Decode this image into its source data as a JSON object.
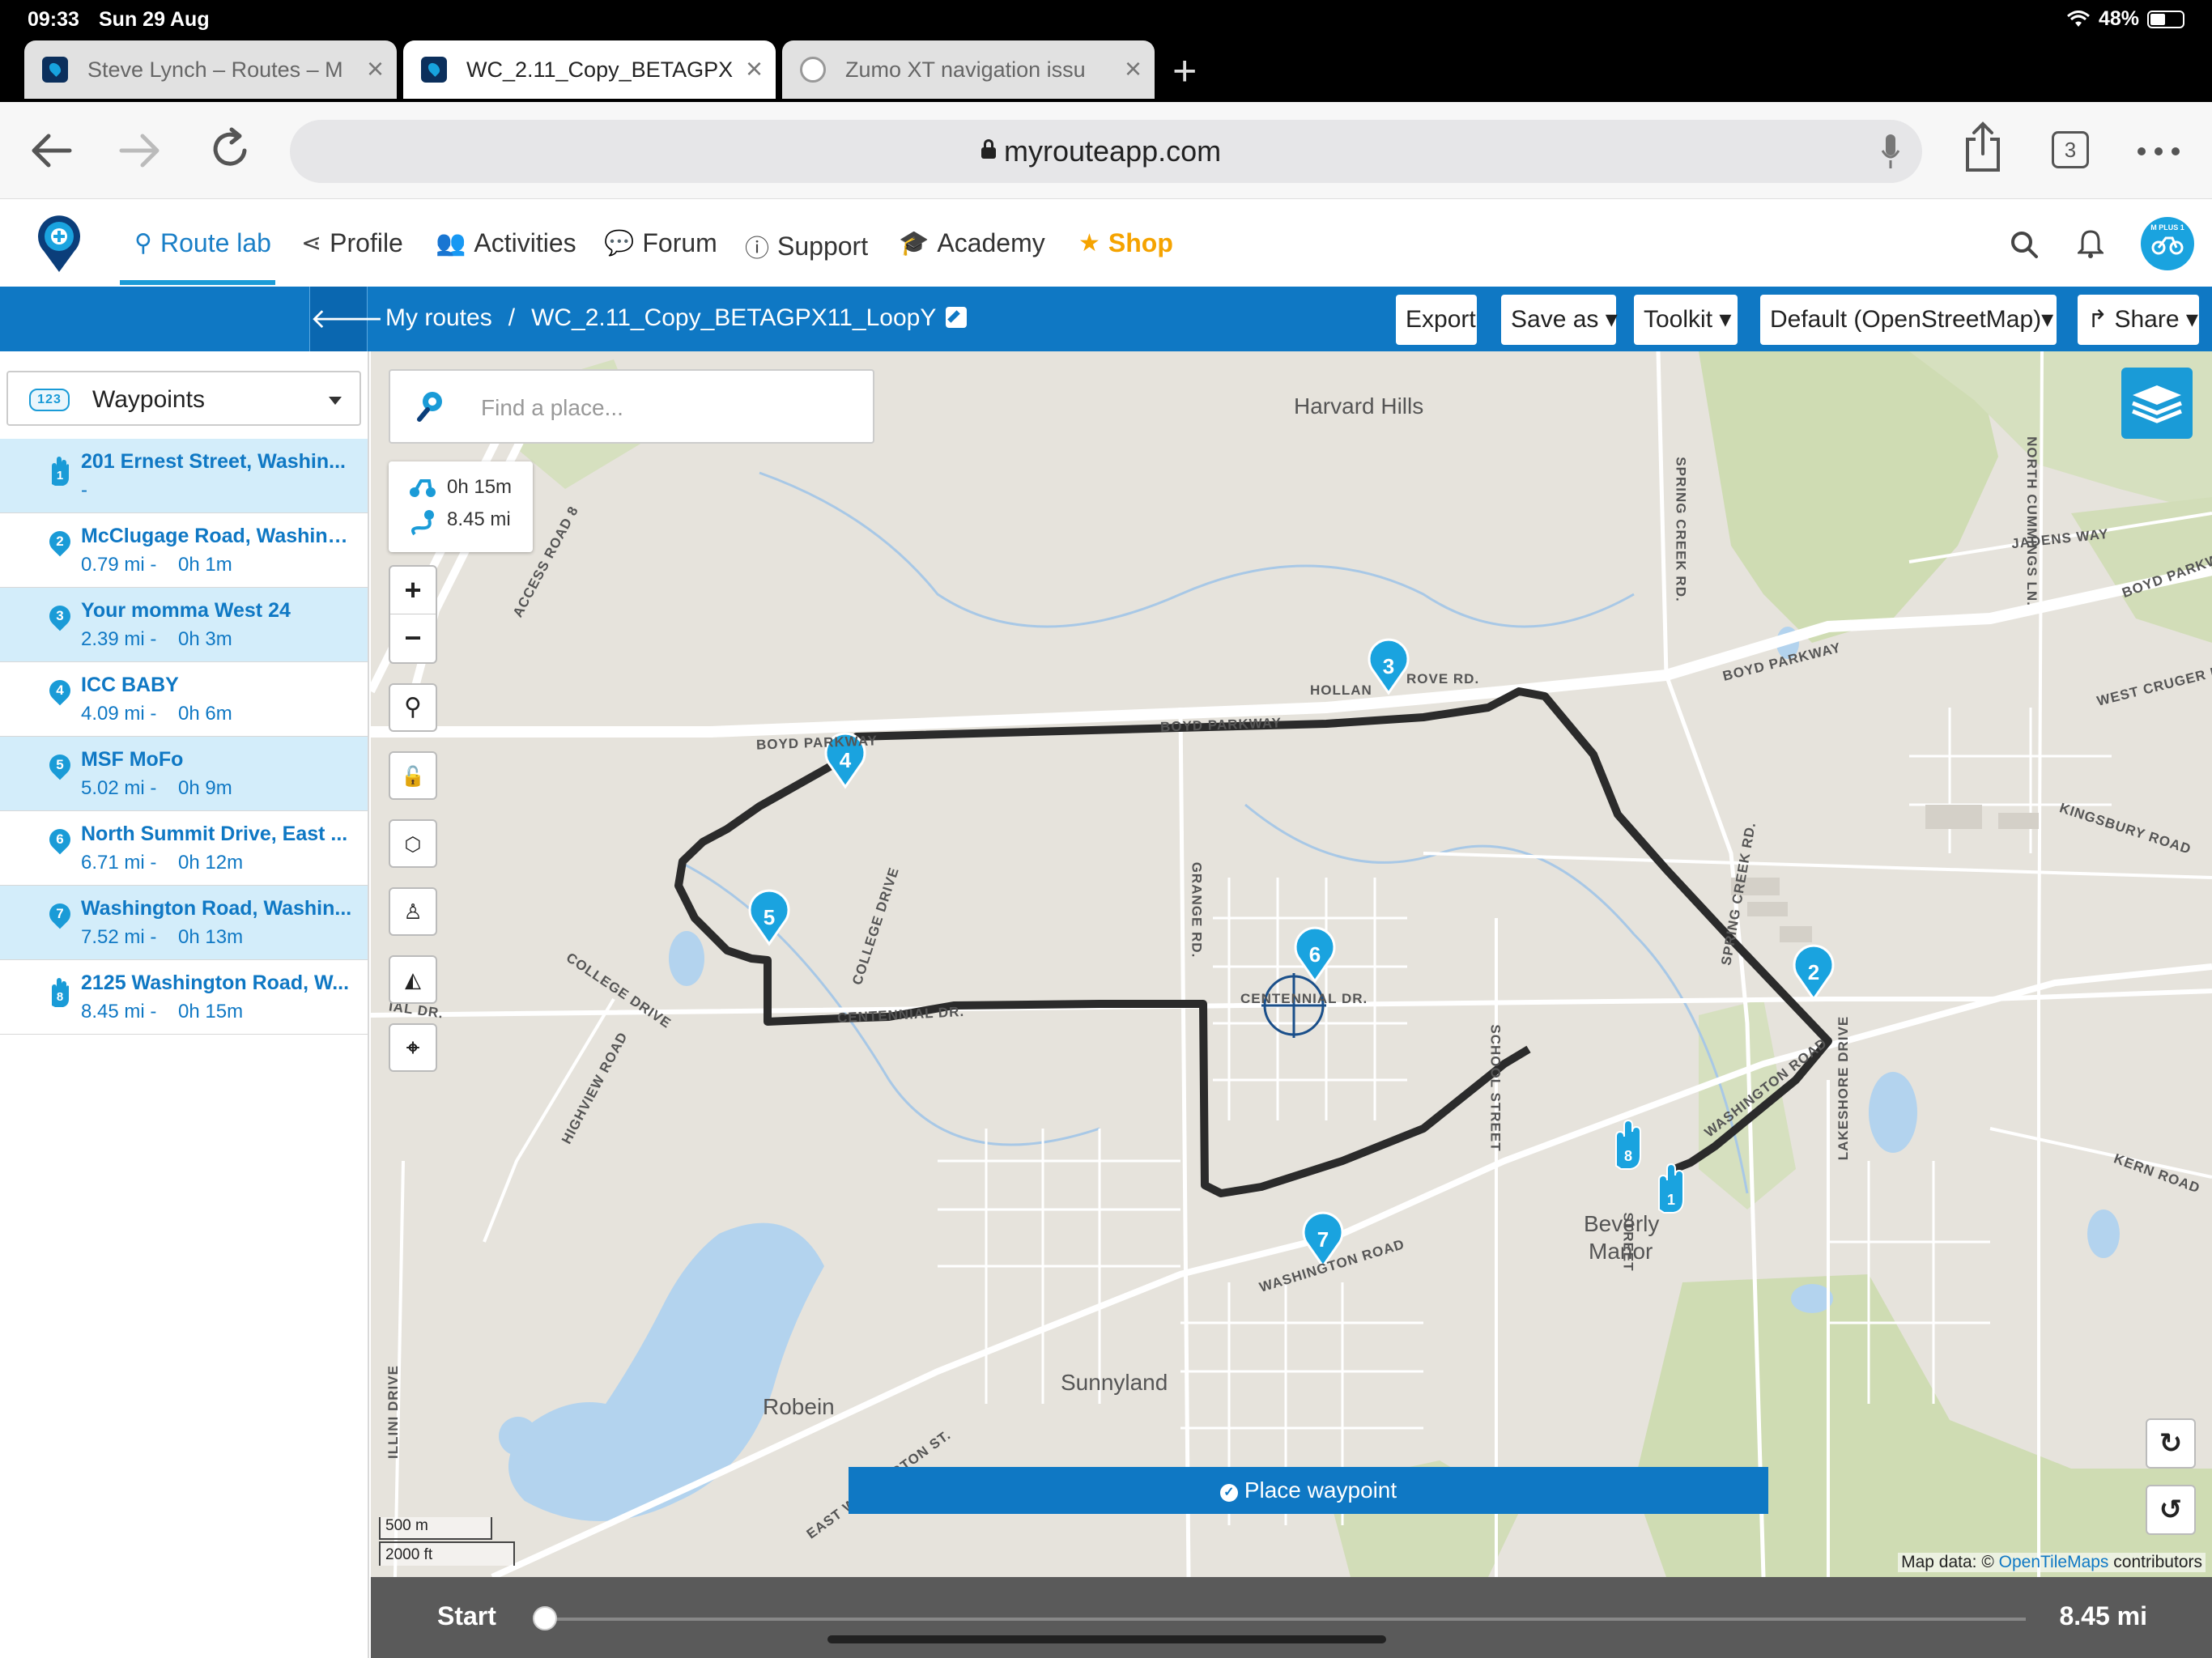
{
  "status": {
    "time": "09:33",
    "date": "Sun 29 Aug",
    "battery": "48%"
  },
  "browser_tabs": [
    {
      "title": "Steve Lynch – Routes – M"
    },
    {
      "title": "WC_2.11_Copy_BETAGPX"
    },
    {
      "title": "Zumo XT navigation issu"
    }
  ],
  "toolbar": {
    "url": "myrouteapp.com",
    "tab_count": "3"
  },
  "nav": {
    "items": [
      "Route lab",
      "Profile",
      "Activities",
      "Forum",
      "Support",
      "Academy"
    ],
    "shop": "Shop",
    "avatar_text": "M PLUS 1"
  },
  "routebar": {
    "crumb_root": "My routes",
    "crumb_sep": "/",
    "route_name": "WC_2.11_Copy_BETAGPX11_LoopY",
    "export": "Export",
    "save_as": "Save as",
    "toolkit": "Toolkit",
    "map_style": "Default (OpenStreetMap)",
    "share": "Share"
  },
  "sidebar": {
    "select_label": "Waypoints",
    "select_icon_text": "123",
    "waypoints": [
      {
        "num": "1",
        "name": "201 Ernest Street, Washin...",
        "meta": "-",
        "type": "start"
      },
      {
        "num": "2",
        "name": "McClugage Road, Washing...",
        "meta": "0.79 mi -    0h 1m",
        "type": "via"
      },
      {
        "num": "3",
        "name": "Your momma West 24",
        "meta": "2.39 mi -    0h 3m",
        "type": "via"
      },
      {
        "num": "4",
        "name": "ICC BABY",
        "meta": "4.09 mi -    0h 6m",
        "type": "via"
      },
      {
        "num": "5",
        "name": "MSF MoFo",
        "meta": "5.02 mi -    0h 9m",
        "type": "via"
      },
      {
        "num": "6",
        "name": "North Summit Drive, East ...",
        "meta": "6.71 mi -    0h 12m",
        "type": "via"
      },
      {
        "num": "7",
        "name": "Washington Road, Washin...",
        "meta": "7.52 mi -    0h 13m",
        "type": "via"
      },
      {
        "num": "8",
        "name": "2125 Washington Road, W...",
        "meta": "8.45 mi -    0h 15m",
        "type": "end"
      }
    ]
  },
  "map": {
    "search_placeholder": "Find a place...",
    "summary_time": "0h 15m",
    "summary_distance": "8.45 mi",
    "place_waypoint": "Place waypoint",
    "scale_metric": "500 m",
    "scale_imperial": "2000 ft",
    "attribution_prefix": "Map data: ©",
    "attribution_link": "OpenTileMaps",
    "attribution_suffix": "contributors",
    "slider_start": "Start",
    "slider_end": "8.45 mi",
    "places": [
      "Harvard Hills",
      "Beverly",
      "Manor",
      "Sunnyland",
      "Robein"
    ],
    "roads": [
      "BOYD PARKWAY",
      "BOYD PARKWAY",
      "BOYD PARKWAY",
      "HOLLAN",
      "ROVE RD.",
      "COLLEGE DRIVE",
      "COLLEGE DRIVE",
      "CENTENNIAL DR.",
      "CENTENNIAL DR.",
      "GRANGE RD.",
      "SCHOOL STREET",
      "SPRING CREEK RD.",
      "SPRING CREEK RD.",
      "HIGHVIEW ROAD",
      "WASHINGTON ROAD",
      "WASHINGTON ROAD",
      "EAST WASHINGTON ST.",
      "JADENS WAY",
      "BOYD PARKW",
      "WEST CRUGER R",
      "KINGSBURY ROAD",
      "LAKESHORE DRIVE",
      "KERN ROAD",
      "NORTH CUMMINGS LN.",
      "ACCESS ROAD 8",
      "ILLINI DRIVE",
      "IAL DR.",
      "STREET"
    ]
  },
  "colors": {
    "brand_blue": "#0f78c4",
    "accent_blue": "#1a9bd7",
    "shop_orange": "#f5a300",
    "route": "#2b2b2b"
  },
  "icons": [
    "back-icon",
    "forward-icon",
    "reload-icon",
    "lock-icon",
    "mic-icon",
    "share-icon",
    "tabs-icon",
    "more-icon",
    "search-icon",
    "bell-icon",
    "layers-icon",
    "locate-icon"
  ]
}
